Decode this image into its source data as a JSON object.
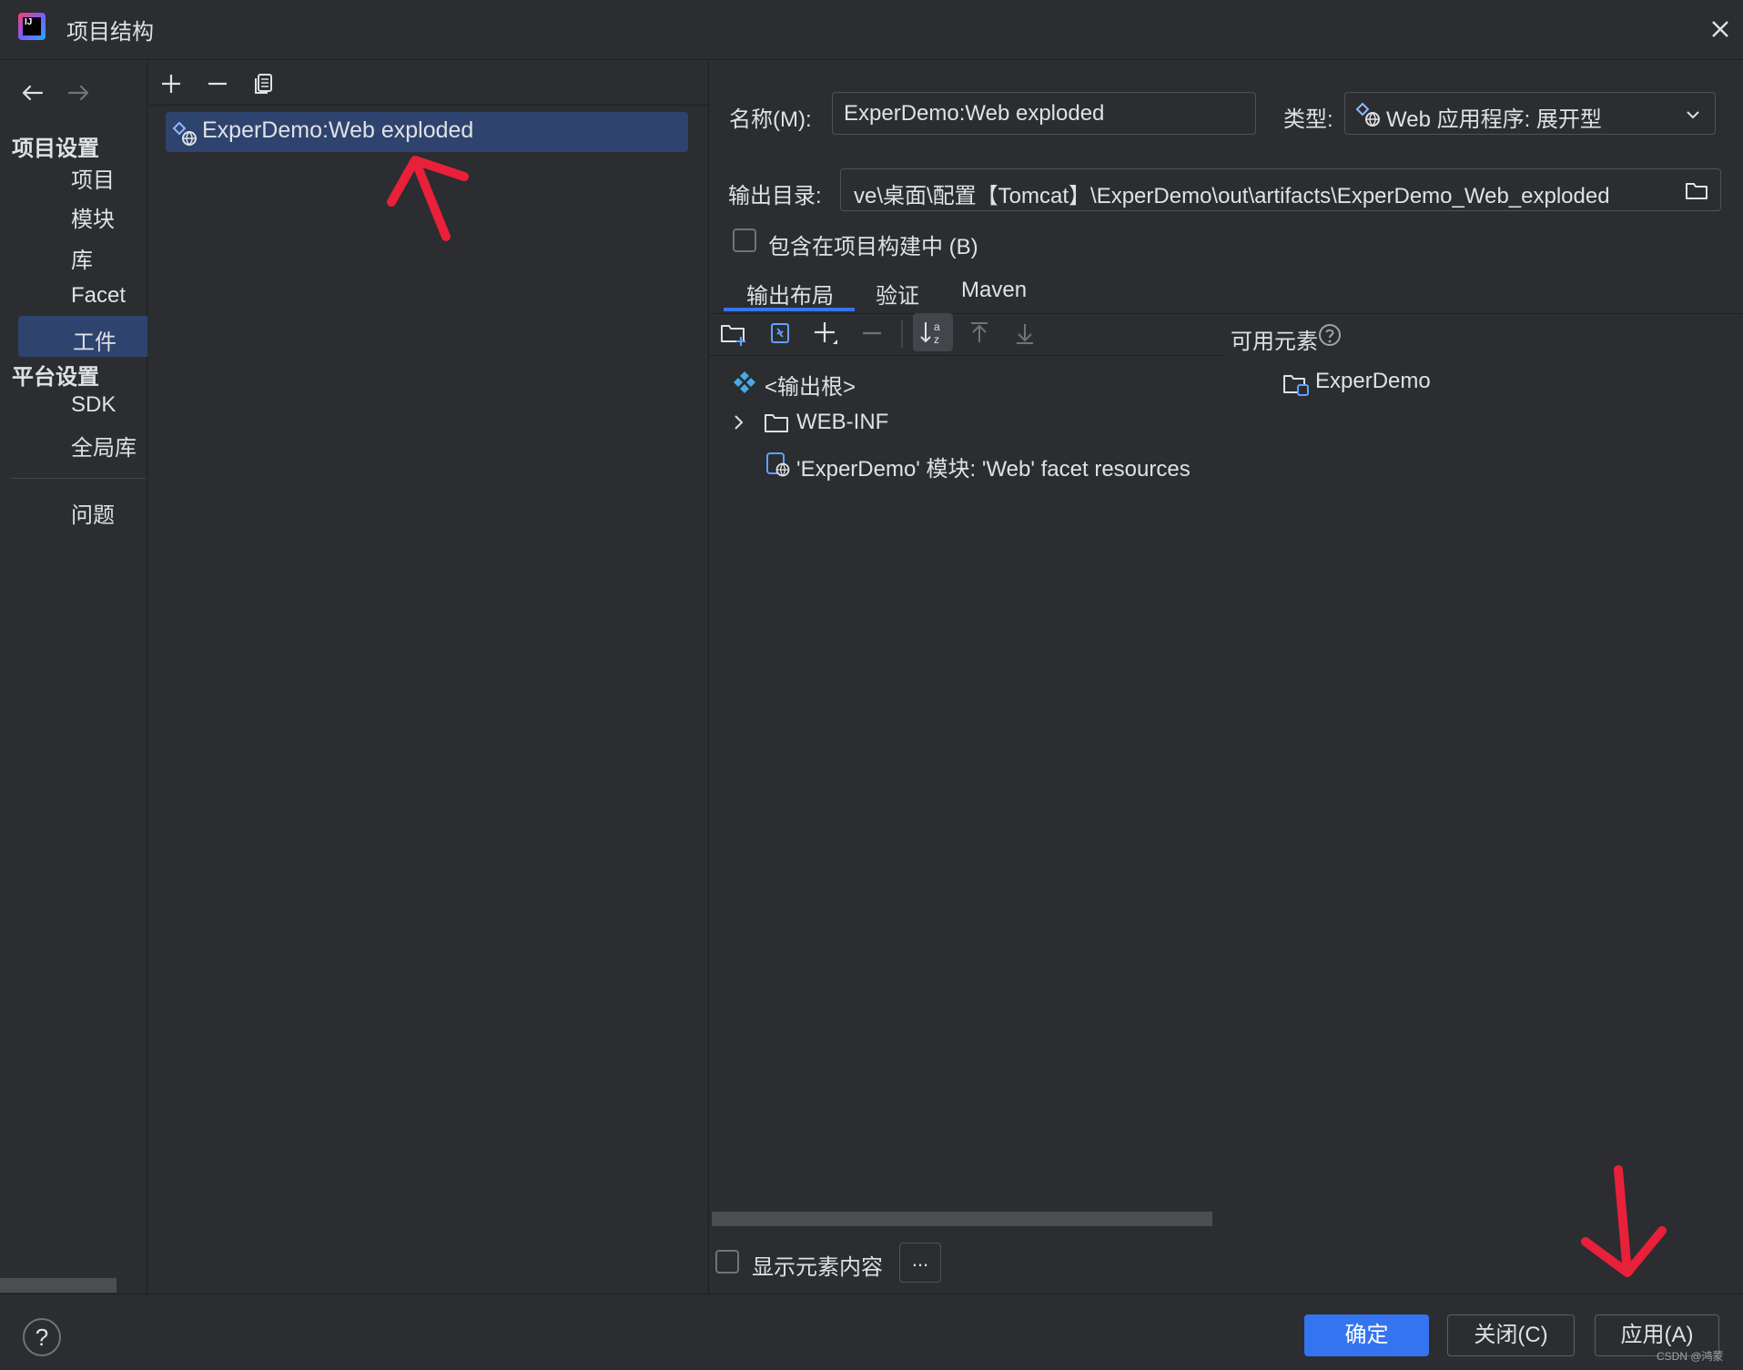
{
  "window": {
    "title": "项目结构",
    "logo_text": "IJ"
  },
  "left_nav": {
    "sections": [
      {
        "title": "项目设置",
        "items": [
          "项目",
          "模块",
          "库",
          "Facet",
          "工件"
        ]
      },
      {
        "title": "平台设置",
        "items": [
          "SDK",
          "全局库"
        ]
      }
    ],
    "problems": "问题",
    "selected": "工件"
  },
  "artifacts": {
    "items": [
      {
        "label": "ExperDemo:Web exploded",
        "selected": true
      }
    ]
  },
  "details": {
    "name_label": "名称(M):",
    "name_value": "ExperDemo:Web exploded",
    "type_label": "类型:",
    "type_value": "Web 应用程序: 展开型",
    "output_label": "输出目录:",
    "output_value": "ve\\桌面\\配置【Tomcat】\\ExperDemo\\out\\artifacts\\ExperDemo_Web_exploded",
    "include_in_build": "包含在项目构建中 (B)",
    "include_checked": false,
    "tabs": [
      "输出布局",
      "验证",
      "Maven"
    ],
    "active_tab": "输出布局",
    "available_label": "可用元素",
    "tree": [
      {
        "label": "<输出根>",
        "icon": "output-root-icon"
      },
      {
        "label": "WEB-INF",
        "icon": "folder-icon",
        "expandable": true
      },
      {
        "label": "'ExperDemo' 模块: 'Web' facet resources",
        "icon": "web-facet-icon"
      }
    ],
    "available_tree": [
      {
        "label": "ExperDemo",
        "icon": "module-folder-icon"
      }
    ],
    "show_content": "显示元素内容",
    "show_content_checked": false,
    "more_button": "..."
  },
  "footer": {
    "help": "?",
    "ok": "确定",
    "close": "关闭(C)",
    "apply": "应用(A)",
    "watermark": "CSDN @鸿蒙"
  },
  "colors": {
    "background": "#2b2d30",
    "selection": "#2e436e",
    "primary_button": "#3574f0",
    "annotation": "#e8203a"
  }
}
